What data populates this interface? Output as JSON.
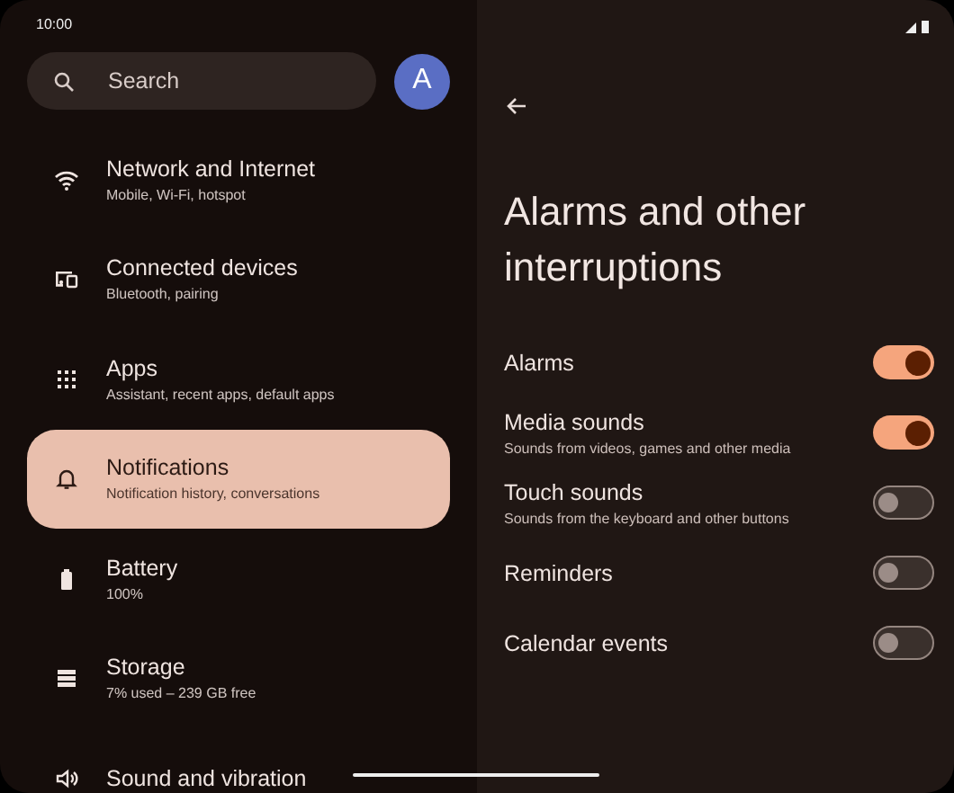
{
  "status_bar": {
    "time": "10:00"
  },
  "search": {
    "placeholder": "Search"
  },
  "account": {
    "initial": "A"
  },
  "settings_menu": [
    {
      "kind": "wifi",
      "title": "Network and Internet",
      "subtitle": "Mobile, Wi-Fi, hotspot",
      "selected": false
    },
    {
      "kind": "devices",
      "title": "Connected devices",
      "subtitle": "Bluetooth, pairing",
      "selected": false
    },
    {
      "kind": "apps",
      "title": "Apps",
      "subtitle": "Assistant, recent apps, default apps",
      "selected": false
    },
    {
      "kind": "bell",
      "title": "Notifications",
      "subtitle": "Notification history, conversations",
      "selected": true
    },
    {
      "kind": "battery",
      "title": "Battery",
      "subtitle": "100%",
      "selected": false
    },
    {
      "kind": "storage",
      "title": "Storage",
      "subtitle": "7% used – 239 GB free",
      "selected": false
    },
    {
      "kind": "sound",
      "title": "Sound and vibration",
      "selected": false
    }
  ],
  "detail": {
    "title": "Alarms and other interruptions",
    "options": [
      {
        "title": "Alarms",
        "on": true
      },
      {
        "title": "Media sounds",
        "subtitle": "Sounds from videos, games and other media",
        "on": true
      },
      {
        "title": "Touch sounds",
        "subtitle": "Sounds from the keyboard and other buttons",
        "on": false
      },
      {
        "title": "Reminders",
        "on": false
      },
      {
        "title": "Calendar events",
        "on": false
      }
    ]
  }
}
